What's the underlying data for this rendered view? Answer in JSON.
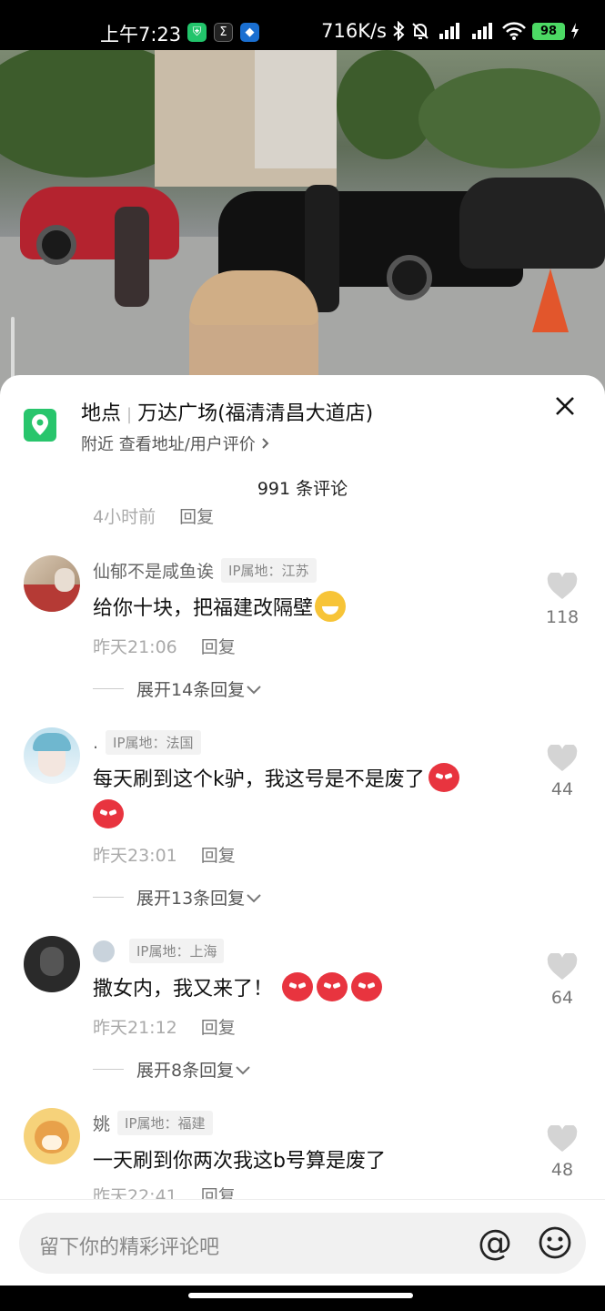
{
  "status_bar": {
    "time": "上午7:23",
    "network_speed": "716K/s",
    "battery": "98"
  },
  "location": {
    "label": "地点",
    "name": "万达广场(福清清昌大道店)",
    "subtitle": "附近  查看地址/用户评价"
  },
  "comments_count": "991 条评论",
  "prev_comment_meta": {
    "time": "4小时前",
    "reply": "回复"
  },
  "comments": [
    {
      "user": "仙郁不是咸鱼诶",
      "ip": "IP属地：江苏",
      "text": "给你十块，把福建改隔壁",
      "time": "昨天21:06",
      "reply": "回复",
      "likes": "118",
      "expand": "展开14条回复"
    },
    {
      "user": ".",
      "ip": "IP属地：法国",
      "text": "每天刷到这个k驴，我这号是不是废了",
      "time": "昨天23:01",
      "reply": "回复",
      "likes": "44",
      "expand": "展开13条回复"
    },
    {
      "user": "",
      "ip": "IP属地：上海",
      "text": "撒女内，我又来了！",
      "time": "昨天21:12",
      "reply": "回复",
      "likes": "64",
      "expand": "展开8条回复"
    },
    {
      "user": "姚",
      "ip": "IP属地：福建",
      "text": "一天刷到你两次我这b号算是废了",
      "time": "昨天22:41",
      "reply": "回复",
      "likes": "48"
    }
  ],
  "input": {
    "placeholder": "留下你的精彩评论吧"
  }
}
